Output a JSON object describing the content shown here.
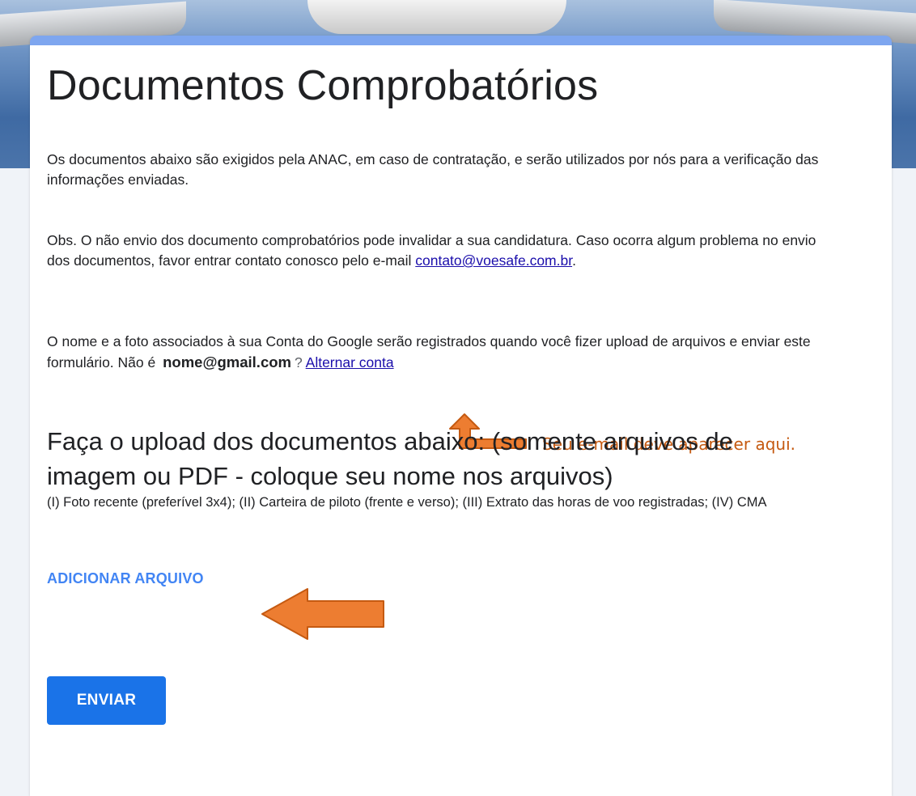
{
  "form": {
    "title": "Documentos Comprobatórios",
    "description_1": "Os documentos abaixo são exigidos pela ANAC, em caso de contratação, e serão utilizados por nós para a verificação das informações enviadas.",
    "obs_text": "Obs. O não envio dos documento comprobatórios pode invalidar a sua candidatura. Caso ocorra algum problema no envio dos documentos, favor entrar contato conosco pelo e-mail ",
    "obs_email_link": "contato@voesafe.com.br",
    "obs_end": ".",
    "account_notice": "O nome e a foto associados à sua Conta do Google serão registrados quando você fizer upload de arquivos e enviar este formulário. Não é",
    "account_email": "nome@gmail.com",
    "account_question": "?",
    "switch_account_link": "Alternar conta"
  },
  "question": {
    "title": "Faça o upload dos documentos abaixo: (somente arquivos de imagem ou PDF - coloque seu nome nos arquivos)",
    "description": "(I) Foto recente (preferível 3x4); (II) Carteira de piloto (frente e verso); (III) Extrato das horas de voo registradas; (IV) CMA",
    "add_file_label": "ADICIONAR ARQUIVO"
  },
  "submit_label": "ENVIAR",
  "annotation": {
    "text": "Seu e-mail deve aparecer aqui."
  },
  "colors": {
    "accent": "#1a73e8",
    "header_bar": "#7ea6ef",
    "link": "#4285f4",
    "annotation": "#c55a11"
  }
}
